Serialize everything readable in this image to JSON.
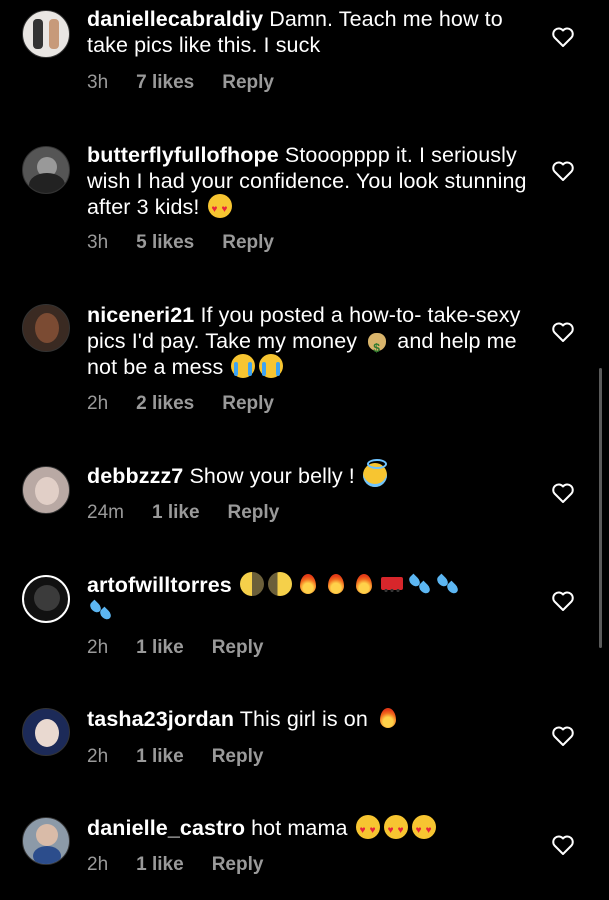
{
  "comments": [
    {
      "username": "daniellecabraldiy",
      "text": "Damn. Teach me how to take pics like this.  I suck",
      "time": "3h",
      "likes": "7 likes",
      "reply": "Reply",
      "avatar_icon": "profile-photo-icon"
    },
    {
      "username": "butterflyfullofhope",
      "text": "Stooopppp it. I seriously wish I had your confidence. You look stunning after 3 kids!",
      "emojis": [
        "heart-eyes"
      ],
      "time": "3h",
      "likes": "5 likes",
      "reply": "Reply",
      "avatar_icon": "profile-photo-icon"
    },
    {
      "username": "niceneri21",
      "text": "If you posted a how-to- take-sexy pics I'd pay. Take my money",
      "emoji_mid": [
        "money-bag"
      ],
      "text2": "and help me not be a mess",
      "emojis": [
        "sob",
        "sob"
      ],
      "time": "2h",
      "likes": "2 likes",
      "reply": "Reply",
      "avatar_icon": "profile-photo-icon"
    },
    {
      "username": "debbzzz7",
      "text": "Show your belly !",
      "emojis": [
        "halo"
      ],
      "time": "24m",
      "likes": "1 like",
      "reply": "Reply",
      "avatar_icon": "profile-photo-icon"
    },
    {
      "username": "artofwilltorres",
      "text": "",
      "emojis": [
        "moon",
        "moon",
        "fire",
        "fire",
        "fire",
        "fire-engine",
        "sweat-droplets",
        "sweat-droplets",
        "sweat-droplets"
      ],
      "time": "2h",
      "likes": "1 like",
      "reply": "Reply",
      "avatar_icon": "profile-photo-icon"
    },
    {
      "username": "tasha23jordan",
      "text": "This girl is on",
      "emojis": [
        "fire"
      ],
      "time": "2h",
      "likes": "1 like",
      "reply": "Reply",
      "avatar_icon": "profile-photo-icon"
    },
    {
      "username": "danielle_castro",
      "text": "hot mama",
      "emojis": [
        "heart-eyes",
        "heart-eyes",
        "heart-eyes"
      ],
      "time": "2h",
      "likes": "1 like",
      "reply": "Reply",
      "avatar_icon": "profile-photo-icon"
    }
  ],
  "like_icon": "heart-outline-icon",
  "colors": {
    "background": "#000000",
    "text": "#ffffff",
    "meta": "#9a9a9a"
  }
}
